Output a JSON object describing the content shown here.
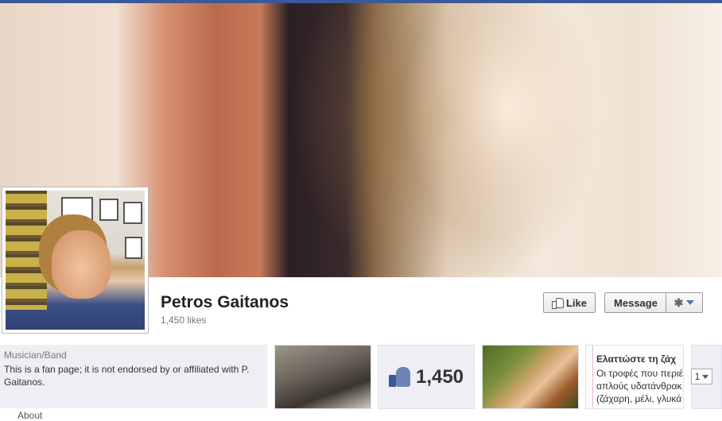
{
  "page": {
    "name": "Petros Gaitanos",
    "likes_text": "1,450 likes"
  },
  "actions": {
    "like_label": "Like",
    "message_label": "Message",
    "gear_icon": "gear-icon"
  },
  "info": {
    "category": "Musician/Band",
    "description": "This is a fan page; it is not endorsed by or affiliated with P. Gaitanos.",
    "about_label": "About"
  },
  "apps": {
    "likes_count": "1,450",
    "note_title": "Ελαττώστε τη ζάχ",
    "note_lines": [
      "Οι τροφές που περιέ",
      "απλούς υδατάνθρακ",
      "(ζάχαρη, μέλι, γλυκά"
    ],
    "pager_value": "1"
  },
  "colors": {
    "brand": "#3b5998",
    "panel": "#edeff4"
  }
}
